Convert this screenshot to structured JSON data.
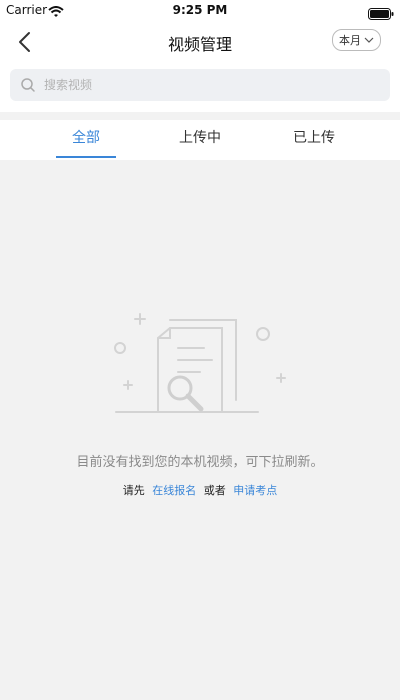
{
  "status_bar": {
    "carrier": "Carrier",
    "time": "9:25 PM"
  },
  "nav": {
    "title": "视频管理",
    "filter_label": "本月"
  },
  "search": {
    "placeholder": "搜索视频"
  },
  "tabs": [
    {
      "label": "全部",
      "active": true
    },
    {
      "label": "上传中",
      "active": false
    },
    {
      "label": "已上传",
      "active": false
    }
  ],
  "empty_state": {
    "message": "目前没有找到您的本机视频，可下拉刷新。",
    "prompt_prefix": "请先",
    "link_signup": "在线报名",
    "prompt_or": "或者",
    "link_exam": "申请考点"
  },
  "colors": {
    "accent": "#3a86d8",
    "background": "#f2f2f2"
  }
}
